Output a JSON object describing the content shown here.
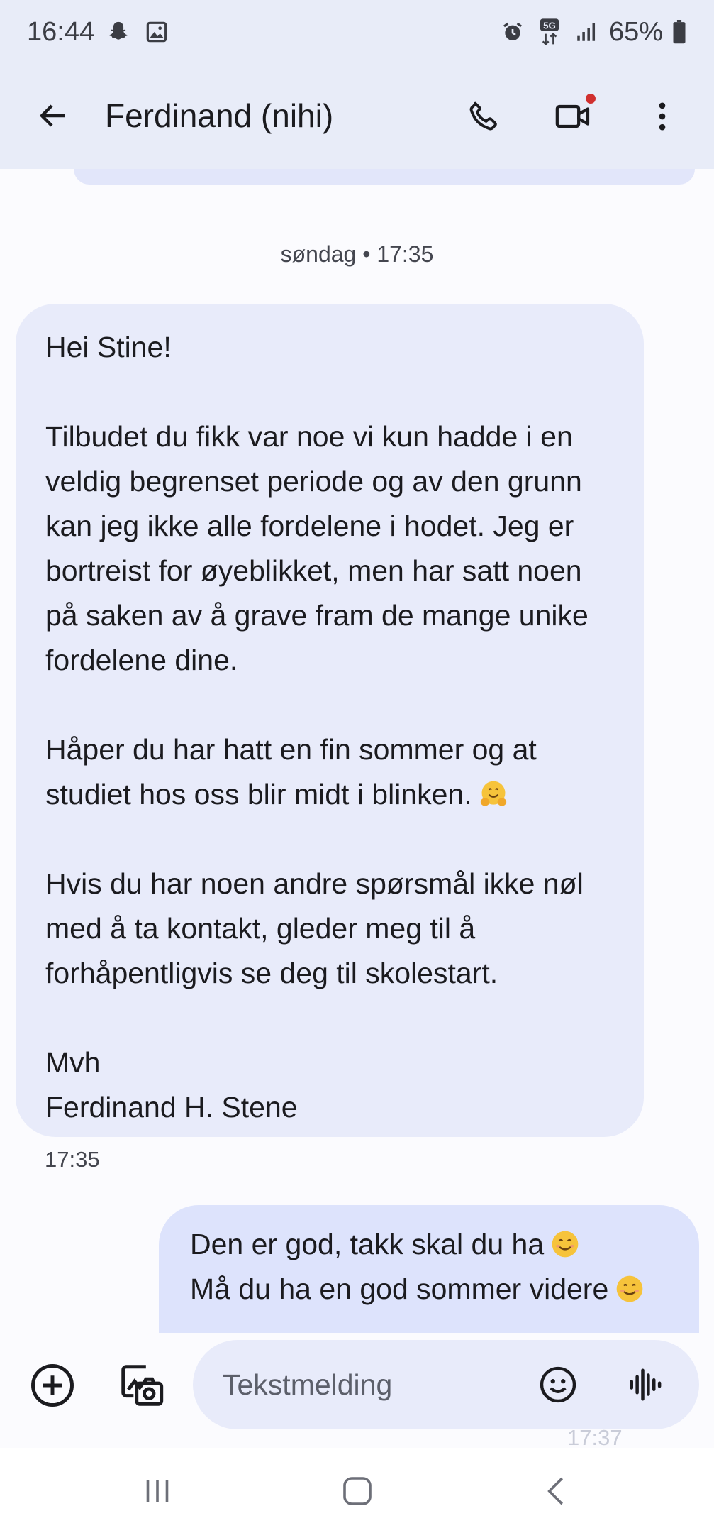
{
  "status_bar": {
    "time": "16:44",
    "network": "5G",
    "battery": "65%",
    "icons": [
      "snapchat-icon",
      "image-icon",
      "alarm-icon",
      "5g-icon",
      "signal-icon",
      "battery-icon"
    ]
  },
  "header": {
    "contact_name": "Ferdinand (nihi)",
    "icons": [
      "back-arrow-icon",
      "phone-icon",
      "video-camera-icon",
      "more-vert-icon"
    ],
    "notification_dot_color": "#d0302f"
  },
  "thread": {
    "date_separator": "søndag • 17:35",
    "incoming": {
      "text": "Hei Stine!\n\nTilbudet du fikk var noe vi kun hadde i en\nveldig begrenset periode og av den grunn\nkan jeg ikke alle fordelene i hodet. Jeg er\nbortreist for øyeblikket, men har satt noen\npå saken av å grave fram de mange unike\nfordelene dine.\n\nHåper du har hatt en fin sommer og at\nstudiet hos oss blir midt i blinken.",
      "text_after_emoji": "\n\nHvis du har noen andre spørsmål ikke nøl\nmed å ta kontakt, gleder meg til å\nforhåpentligvis se deg til skolestart.\n\nMvh\nFerdinand H. Stene",
      "emoji": "hugging-face-emoji",
      "time": "17:35"
    },
    "outgoing": {
      "line1": "Den er god, takk skal du ha",
      "line2": "Må du ha en god sommer videre",
      "emoji": "smiling-face-emoji",
      "status": "17:37"
    }
  },
  "composer": {
    "placeholder": "Tekstmelding",
    "icons": [
      "add-circle-icon",
      "gallery-camera-icon",
      "emoji-icon",
      "voice-wave-icon"
    ]
  },
  "nav_bar": {
    "icons": [
      "recents-icon",
      "home-icon",
      "nav-back-icon"
    ]
  },
  "colors": {
    "header_bg": "#e8ecf8",
    "incoming_bubble": "#e8ebfa",
    "outgoing_bubble": "#dde3fc",
    "background": "#fbfbfe"
  }
}
